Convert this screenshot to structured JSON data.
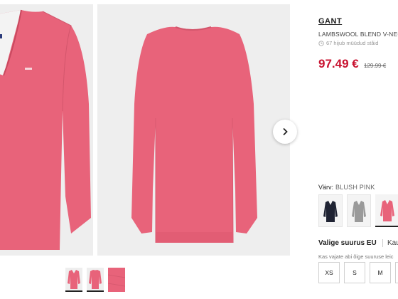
{
  "product": {
    "brand": "GANT",
    "name": "LAMBSWOOL BLEND V-NECK",
    "sold_text": "67 hijub müüdud ståid",
    "price": "97.49 €",
    "old_price": "129.99 €",
    "accent_color": "#c8102e",
    "sweater_color": "#e8637a"
  },
  "gallery": {
    "next_icon": "chevron-right-icon",
    "thumbnail_count": 3
  },
  "color": {
    "label": "Värv:",
    "value": "BLUSH PINK",
    "swatches": [
      {
        "name": "navy",
        "color": "#1f2333"
      },
      {
        "name": "grey",
        "color": "#9a9a9a"
      },
      {
        "name": "blush-pink",
        "color": "#e8637a",
        "selected": true
      }
    ]
  },
  "size": {
    "title": "Valige suurus EU",
    "guide_label": "Kaub",
    "help_text": "Kas vajate abi õige suuruse leic",
    "options": [
      "XS",
      "S",
      "M",
      ""
    ]
  }
}
